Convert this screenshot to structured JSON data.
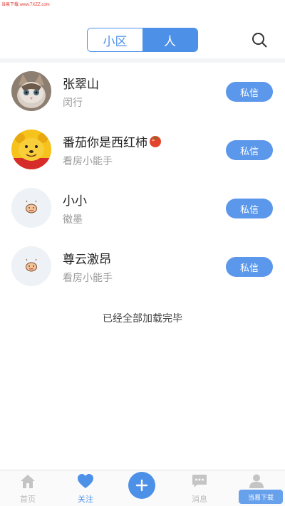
{
  "watermark_top": "当易下载 www.7XZZ.com",
  "header": {
    "tabs": [
      {
        "label": "小区",
        "active": false
      },
      {
        "label": "人",
        "active": true
      }
    ],
    "search_icon": "search-icon"
  },
  "users": [
    {
      "name": "张翠山",
      "sub": "闵行",
      "button": "私信",
      "avatar": "cat-photo"
    },
    {
      "name": "番茄你是西红柿",
      "sub": "看房小能手",
      "button": "私信",
      "avatar": "bear-photo",
      "name_emoji": "tomato"
    },
    {
      "name": "小小",
      "sub": "徽墨",
      "button": "私信",
      "avatar": "default-avatar"
    },
    {
      "name": "尊云激昂",
      "sub": "看房小能手",
      "button": "私信",
      "avatar": "default-avatar"
    }
  ],
  "list_end_text": "已经全部加载完毕",
  "bottom_nav": {
    "home": "首页",
    "follow": "关注",
    "messages": "消息",
    "active": "follow"
  },
  "watermark_br": "当易下载",
  "colors": {
    "accent": "#4d90e8",
    "button": "#5b97ea",
    "muted": "#9a9a9a"
  }
}
